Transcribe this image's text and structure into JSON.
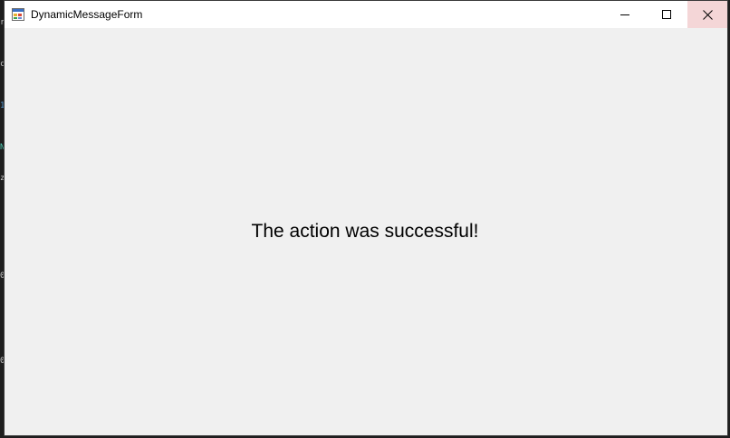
{
  "window": {
    "title": "DynamicMessageForm",
    "icon": "winforms-app-icon",
    "controls": {
      "minimize_icon": "minimize-icon",
      "maximize_icon": "maximize-icon",
      "close_icon": "close-icon",
      "close_hover_color": "#f4d6d7"
    }
  },
  "content": {
    "message": "The action was successful!",
    "background_color": "#f0f0f0"
  }
}
